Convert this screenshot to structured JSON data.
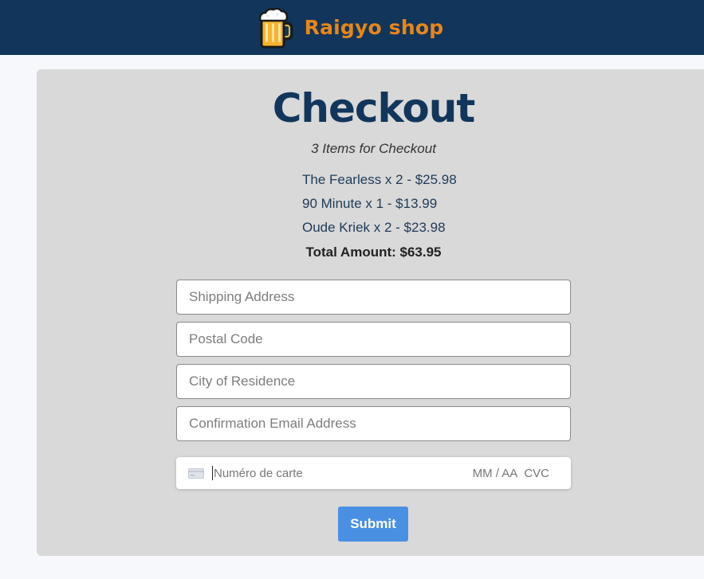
{
  "header": {
    "brand_name": "Raigyo shop",
    "logo_icon": "beer-mug-icon",
    "background": "#12365b",
    "brand_color": "#e8861a"
  },
  "checkout": {
    "title": "Checkout",
    "subtitle": "3 Items for Checkout",
    "items": [
      "The Fearless x 2 - $25.98",
      "90 Minute x 1 - $13.99",
      "Oude Kriek x 2 - $23.98"
    ],
    "total": "Total Amount: $63.95"
  },
  "form": {
    "shipping_placeholder": "Shipping Address",
    "postal_placeholder": "Postal Code",
    "city_placeholder": "City of Residence",
    "email_placeholder": "Confirmation Email Address",
    "shipping_value": "",
    "postal_value": "",
    "city_value": "",
    "email_value": "",
    "card": {
      "icon": "credit-card-icon",
      "number_placeholder": "Numéro de carte",
      "expiry_placeholder": "MM / AA",
      "cvc_placeholder": "CVC"
    },
    "submit_label": "Submit",
    "submit_color": "#4a90e2"
  }
}
